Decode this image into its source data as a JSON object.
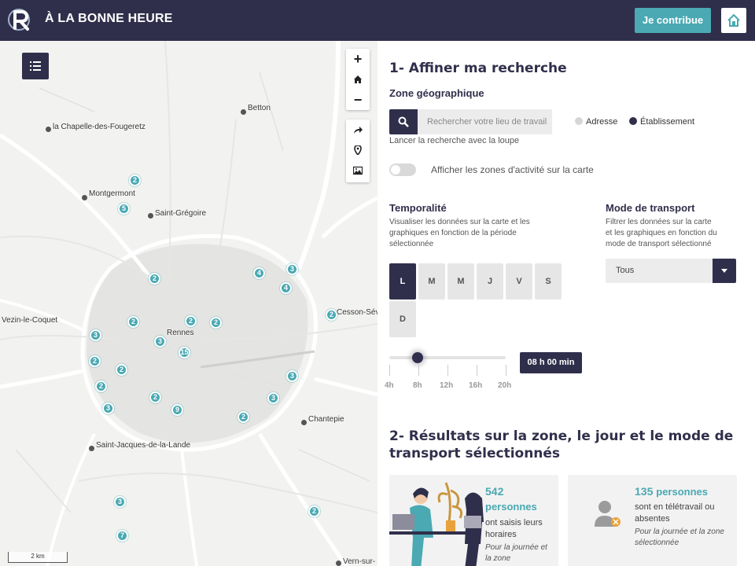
{
  "header": {
    "title": "À LA BONNE HEURE",
    "contribute_label": "Je contribue",
    "home_icon": "home-icon",
    "logo_letter": "R"
  },
  "map": {
    "places": [
      {
        "name": "Betton"
      },
      {
        "name": "la Chapelle-des-Fougeretz"
      },
      {
        "name": "Montgermont"
      },
      {
        "name": "Saint-Grégoire"
      },
      {
        "name": "Vezin-le-Coquet"
      },
      {
        "name": "Rennes"
      },
      {
        "name": "Cesson-Sévi"
      },
      {
        "name": "Chantepie"
      },
      {
        "name": "Saint-Jacques-de-la-Lande"
      },
      {
        "name": "Vern-sur-"
      }
    ],
    "clusters": [
      "2",
      "5",
      "2",
      "4",
      "3",
      "4",
      "2",
      "2",
      "2",
      "2",
      "3",
      "15",
      "3",
      "2",
      "2",
      "2",
      "3",
      "2",
      "3",
      "9",
      "3",
      "2",
      "3",
      "2",
      "7"
    ],
    "scale_label": "2 km"
  },
  "panel": {
    "section1_title": "1- Affiner ma recherche",
    "zone_title": "Zone géographique",
    "search_placeholder": "Rechercher votre lieu de travail",
    "search_hint": "Lancer la recherche avec la loupe",
    "radio_address": "Adresse",
    "radio_establishment": "Établissement",
    "toggle_label": "Afficher les zones d'activité sur la carte",
    "temporal_title": "Temporalité",
    "temporal_desc_1": "Visualiser les données sur la carte et les",
    "temporal_desc_2": "graphiques en fonction de la période",
    "temporal_desc_3": "sélectionnée",
    "days": [
      "L",
      "M",
      "M",
      "J",
      "V",
      "S",
      "D"
    ],
    "active_day": "L",
    "ticks": [
      "4h",
      "8h",
      "12h",
      "16h",
      "20h"
    ],
    "time_value": "08 h 00 min",
    "transport_title": "Mode de transport",
    "transport_desc_1": "Filtrer les données sur la carte",
    "transport_desc_2": "et les graphiques en fonction du",
    "transport_desc_3": "mode de transport sélectionné",
    "transport_value": "Tous",
    "section2_title_1": "2- Résultats sur la zone, le jour et le mode de",
    "section2_title_2": "transport sélectionnés",
    "card1_number": "542",
    "card1_unit": "personnes",
    "card1_text_1": "ont saisis leurs",
    "card1_text_2": "horaires",
    "card1_italic_1": "Pour la journée et",
    "card1_italic_2": "la zone",
    "card2_number": "135",
    "card2_unit": "personnes",
    "card2_text_1": "sont en télétravail ou",
    "card2_text_2": "absentes",
    "card2_italic_1": "Pour la journée et la zone",
    "card2_italic_2": "sélectionnée"
  },
  "colors": {
    "navy": "#302f4b",
    "teal": "#4aa9b3"
  }
}
